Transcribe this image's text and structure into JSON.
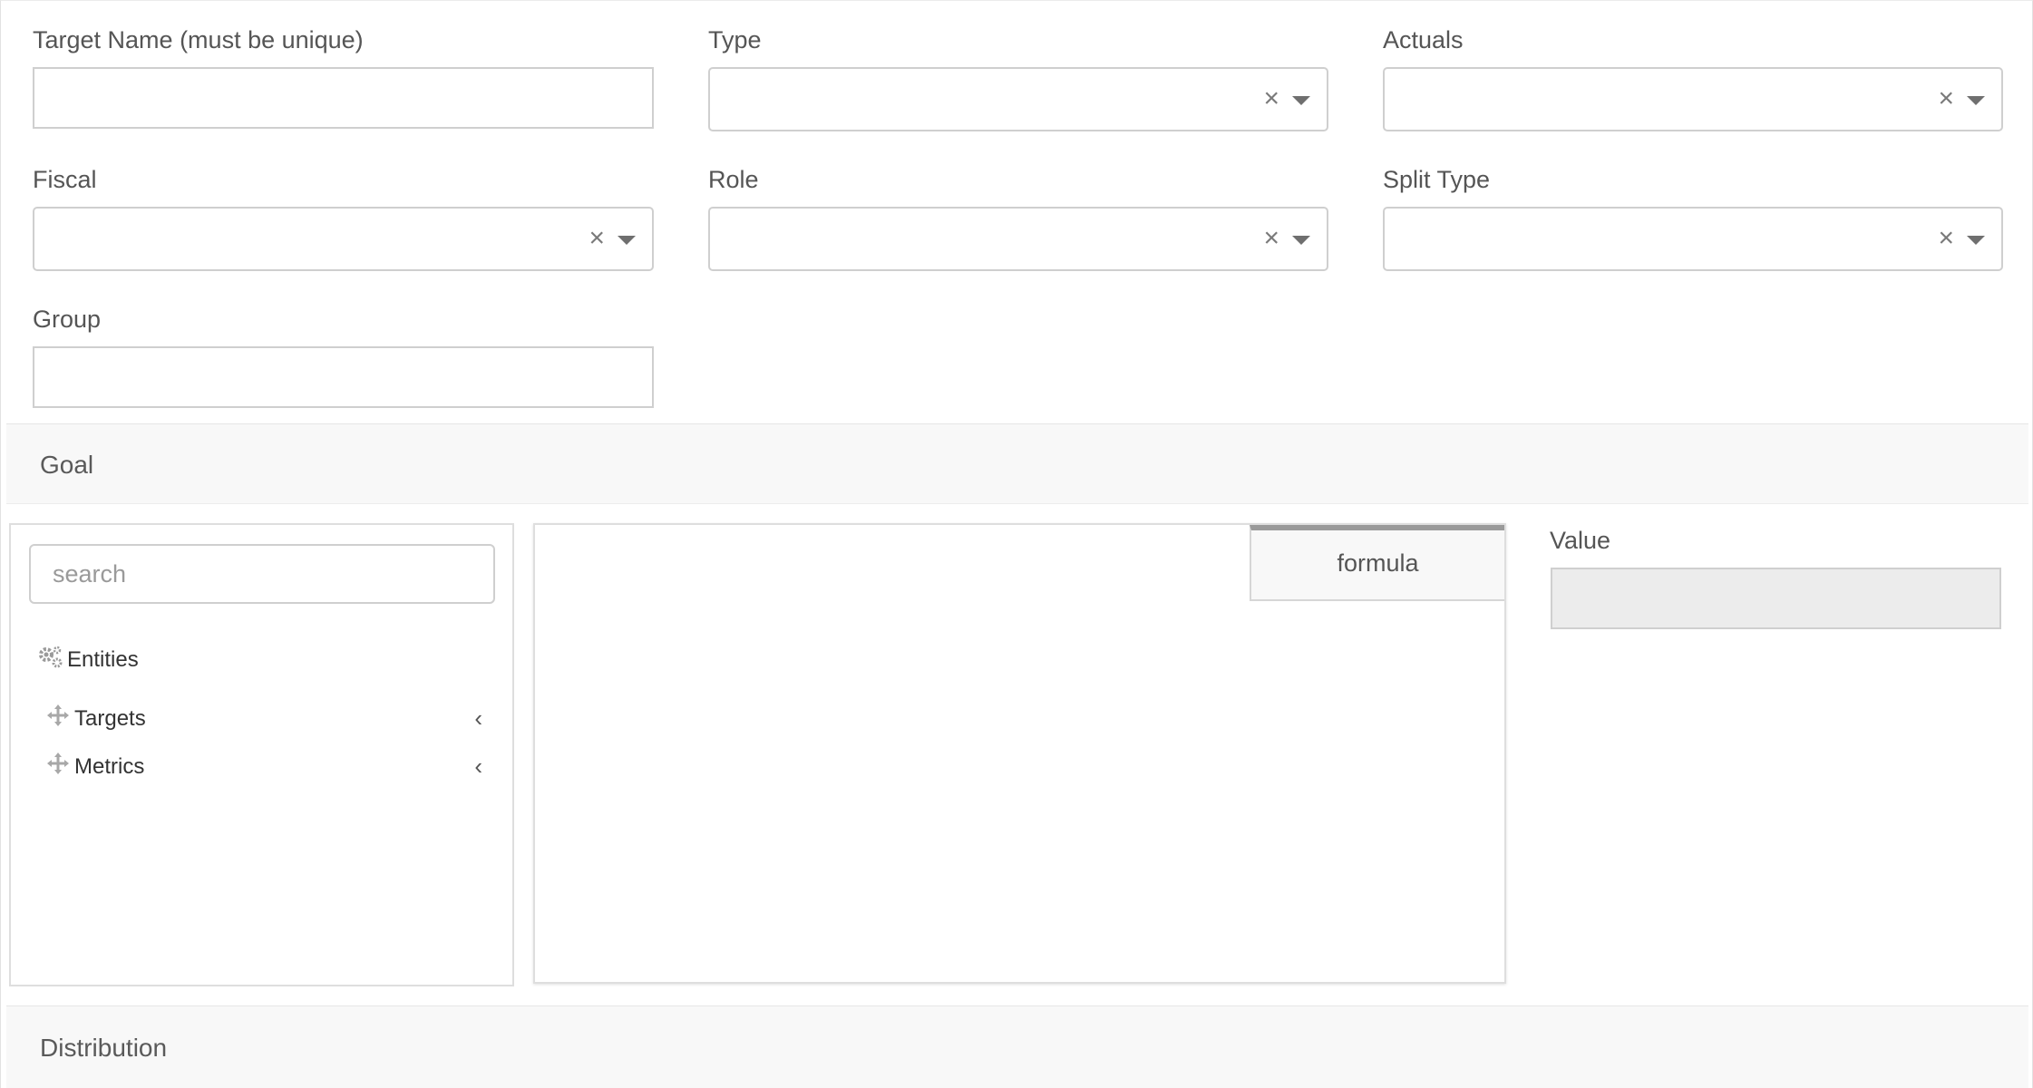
{
  "fields": {
    "target_name": {
      "label": "Target Name (must be unique)",
      "value": ""
    },
    "type": {
      "label": "Type",
      "value": ""
    },
    "actuals": {
      "label": "Actuals",
      "value": ""
    },
    "fiscal": {
      "label": "Fiscal",
      "value": ""
    },
    "role": {
      "label": "Role",
      "value": ""
    },
    "split_type": {
      "label": "Split Type",
      "value": ""
    },
    "group": {
      "label": "Group",
      "value": ""
    }
  },
  "select_icons": {
    "clear": "×",
    "caret": "chevron-down-icon"
  },
  "goal": {
    "title": "Goal",
    "search": {
      "placeholder": "search",
      "value": ""
    },
    "tree": {
      "root": {
        "label": "Entities",
        "icon": "gears-icon"
      },
      "items": [
        {
          "label": "Targets",
          "icon": "move-icon",
          "chevron": "‹"
        },
        {
          "label": "Metrics",
          "icon": "move-icon",
          "chevron": "‹"
        }
      ]
    },
    "formula_tab": "formula",
    "value": {
      "label": "Value",
      "value": ""
    }
  },
  "distribution": {
    "title": "Distribution"
  },
  "colors": {
    "section_bg": "#f8f8f8",
    "border": "#cfcfcf",
    "text": "#555555",
    "disabled_bg": "#ececec"
  }
}
